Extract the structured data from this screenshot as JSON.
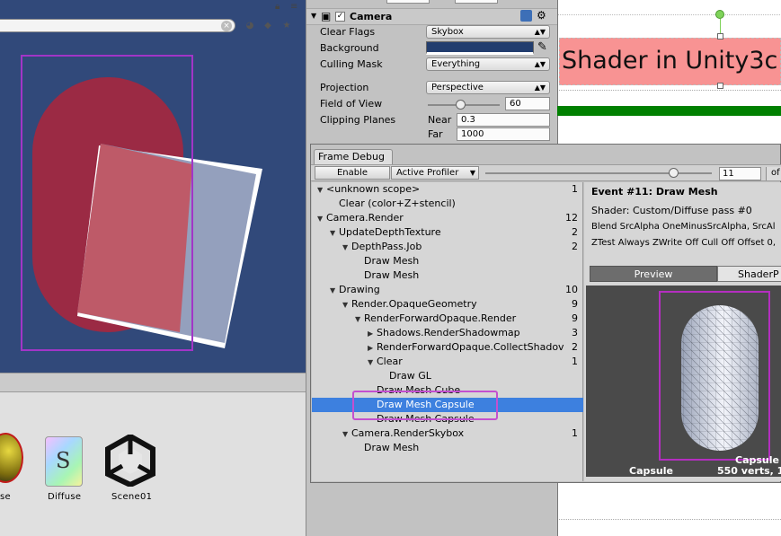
{
  "inspector": {
    "component_title": "Camera",
    "rows": {
      "clear_flags": {
        "label": "Clear Flags",
        "value": "Skybox"
      },
      "background": {
        "label": "Background",
        "color": "#223d6e"
      },
      "culling_mask": {
        "label": "Culling Mask",
        "value": "Everything"
      },
      "projection": {
        "label": "Projection",
        "value": "Perspective"
      },
      "field_of_view": {
        "label": "Field of View",
        "value": "60",
        "slider_fraction": 0.45
      },
      "clipping_planes": {
        "label": "Clipping Planes",
        "near_label": "Near",
        "near_value": "0.3",
        "far_label": "Far",
        "far_value": "1000"
      }
    }
  },
  "gameview": {
    "banner_text": "Shader in Unity3c"
  },
  "frame_debug": {
    "tab_title": "Frame Debug",
    "enable_label": "Enable",
    "profiler_label": "Active Profiler",
    "event_slider_fraction": 0.83,
    "event_value": "11",
    "of_label": "of",
    "tree": [
      {
        "label": "<unknown scope>",
        "count": "1",
        "depth": 0,
        "expander": "open"
      },
      {
        "label": "Clear (color+Z+stencil)",
        "count": "",
        "depth": 1,
        "expander": "none"
      },
      {
        "label": "Camera.Render",
        "count": "12",
        "depth": 0,
        "expander": "open"
      },
      {
        "label": "UpdateDepthTexture",
        "count": "2",
        "depth": 1,
        "expander": "open"
      },
      {
        "label": "DepthPass.Job",
        "count": "2",
        "depth": 2,
        "expander": "open"
      },
      {
        "label": "Draw Mesh",
        "count": "",
        "depth": 3,
        "expander": "none"
      },
      {
        "label": "Draw Mesh",
        "count": "",
        "depth": 3,
        "expander": "none"
      },
      {
        "label": "Drawing",
        "count": "10",
        "depth": 1,
        "expander": "open"
      },
      {
        "label": "Render.OpaqueGeometry",
        "count": "9",
        "depth": 2,
        "expander": "open"
      },
      {
        "label": "RenderForwardOpaque.Render",
        "count": "9",
        "depth": 3,
        "expander": "open"
      },
      {
        "label": "Shadows.RenderShadowmap",
        "count": "3",
        "depth": 4,
        "expander": "closed"
      },
      {
        "label": "RenderForwardOpaque.CollectShadov",
        "count": "2",
        "depth": 4,
        "expander": "closed"
      },
      {
        "label": "Clear",
        "count": "1",
        "depth": 4,
        "expander": "open"
      },
      {
        "label": "Draw GL",
        "count": "",
        "depth": 5,
        "expander": "none"
      },
      {
        "label": "Draw Mesh Cube",
        "count": "",
        "depth": 4,
        "expander": "none"
      },
      {
        "label": "Draw Mesh Capsule",
        "count": "",
        "depth": 4,
        "expander": "none",
        "selected": true
      },
      {
        "label": "Draw Mesh Capsule",
        "count": "",
        "depth": 4,
        "expander": "none"
      },
      {
        "label": "Camera.RenderSkybox",
        "count": "1",
        "depth": 2,
        "expander": "open"
      },
      {
        "label": "Draw Mesh",
        "count": "",
        "depth": 3,
        "expander": "none"
      }
    ],
    "detail": {
      "event_title": "Event #11: Draw Mesh",
      "shader_line": "Shader: Custom/Diffuse pass #0",
      "blend_line": "Blend SrcAlpha OneMinusSrcAlpha, SrcAl",
      "ztest_line": "ZTest Always ZWrite Off Cull Off Offset 0,"
    },
    "preview": {
      "preview_tab": "Preview",
      "shader_tab": "ShaderP",
      "mesh_label": "Capsule",
      "mesh_name_overlay": "Capsule",
      "stats": "550 verts, 1"
    }
  },
  "project": {
    "assets": [
      {
        "name": "se"
      },
      {
        "name": "Diffuse",
        "glyph": "S"
      },
      {
        "name": "Scene01"
      }
    ]
  }
}
